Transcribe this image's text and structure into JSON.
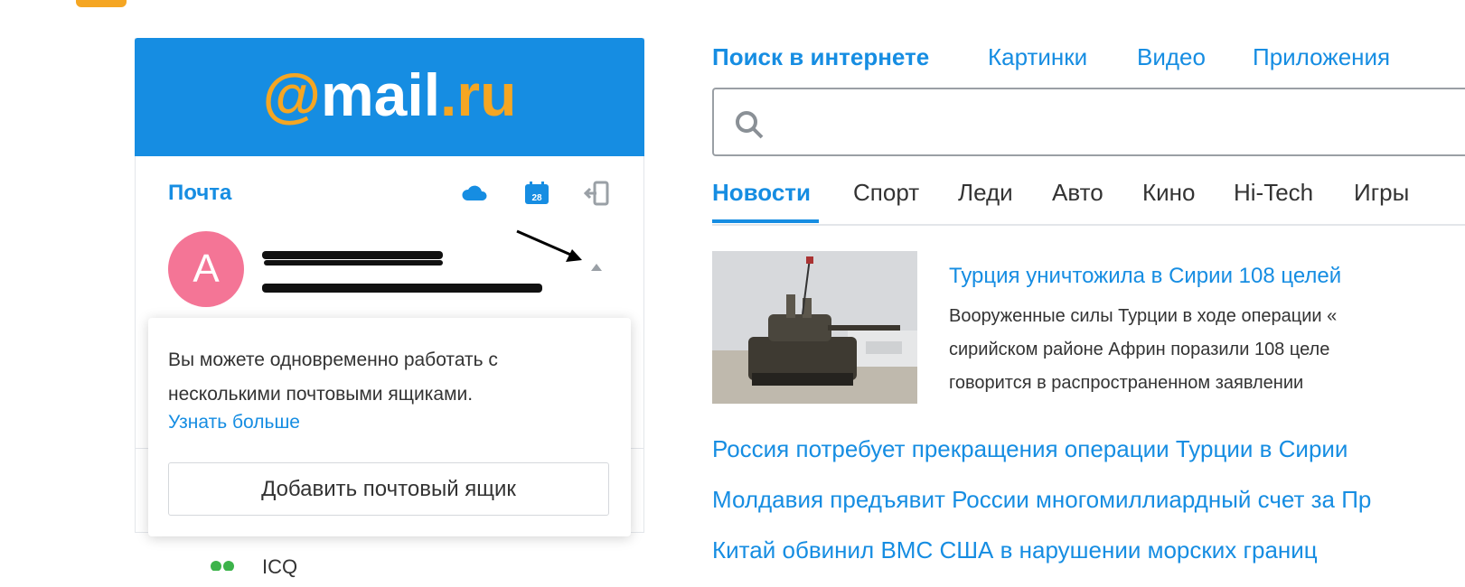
{
  "mail": {
    "logo_text_at": "@",
    "logo_text_mail": "mail",
    "logo_text_dot": ".",
    "logo_text_ru": "ru",
    "title": "Почта",
    "avatar_letter": "А",
    "popup_text": "Вы можете одновременно работать с несколькими почтовыми ящиками.",
    "popup_link": "Узнать больше",
    "add_button": "Добавить почтовый ящик",
    "bottom_item": "ICQ"
  },
  "search": {
    "tabs": [
      "Поиск в интернете",
      "Картинки",
      "Видео",
      "Приложения"
    ]
  },
  "news": {
    "tabs": [
      "Новости",
      "Спорт",
      "Леди",
      "Авто",
      "Кино",
      "Hi-Tech",
      "Игры"
    ],
    "lead_title": "Турция уничтожила в Сирии 108 целей",
    "lead_desc_1": "Вооруженные силы Турции в ходе операции «",
    "lead_desc_2": "сирийском районе Африн поразили 108 целе",
    "lead_desc_3": "говорится в распространенном заявлении",
    "items": [
      "Россия потребует прекращения операции Турции в Сирии",
      "Молдавия предъявит России многомиллиардный счет за Пр",
      "Китай обвинил ВМС США в нарушении морских границ"
    ]
  },
  "colors": {
    "brand_blue": "#168de2",
    "logo_orange": "#f5a623",
    "avatar_pink": "#f47596"
  },
  "icons": [
    "cloud-icon",
    "calendar-icon",
    "logout-icon",
    "search-icon",
    "caret-up-icon",
    "icq-icon"
  ]
}
